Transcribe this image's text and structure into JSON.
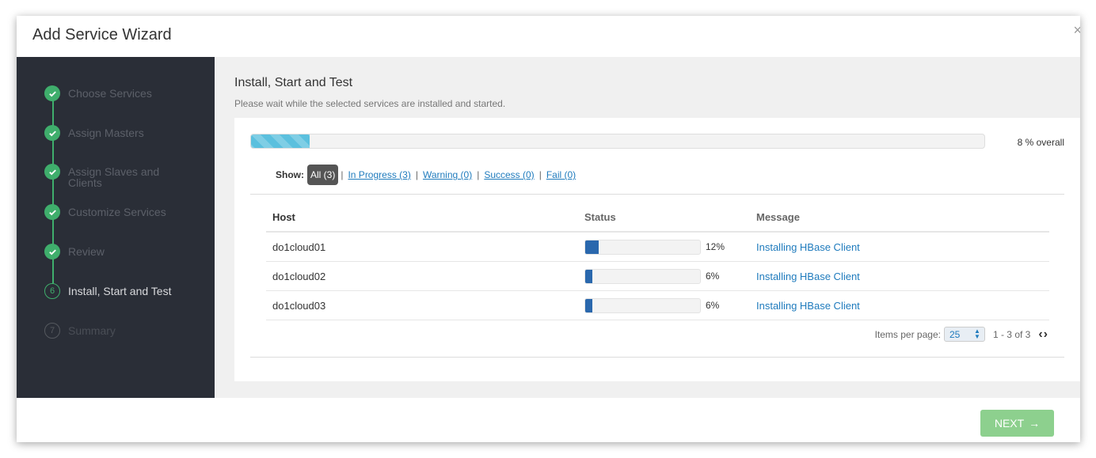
{
  "dialog": {
    "title": "Add Service Wizard",
    "close_glyph": "×"
  },
  "steps": [
    {
      "label": "Choose Services",
      "state": "done",
      "badge": ""
    },
    {
      "label": "Assign Masters",
      "state": "done",
      "badge": ""
    },
    {
      "label": "Assign Slaves and Clients",
      "state": "done",
      "badge": ""
    },
    {
      "label": "Customize Services",
      "state": "done",
      "badge": ""
    },
    {
      "label": "Review",
      "state": "done",
      "badge": ""
    },
    {
      "label": "Install, Start and Test",
      "state": "current",
      "badge": "6"
    },
    {
      "label": "Summary",
      "state": "future",
      "badge": "7"
    }
  ],
  "content": {
    "title": "Install, Start and Test",
    "subtitle": "Please wait while the selected services are installed and started."
  },
  "overall": {
    "percent": 8,
    "text": "8 % overall"
  },
  "filter": {
    "label": "Show:",
    "all": "All (3)",
    "separator": "|",
    "in_progress": "In Progress (3)",
    "warning": "Warning (0)",
    "success": "Success (0)",
    "fail": "Fail (0)"
  },
  "table": {
    "headers": {
      "host": "Host",
      "status": "Status",
      "message": "Message"
    },
    "rows": [
      {
        "host": "do1cloud01",
        "percent": 12,
        "percent_text": "12%",
        "message": "Installing HBase Client"
      },
      {
        "host": "do1cloud02",
        "percent": 6,
        "percent_text": "6%",
        "message": "Installing HBase Client"
      },
      {
        "host": "do1cloud03",
        "percent": 6,
        "percent_text": "6%",
        "message": "Installing HBase Client"
      }
    ]
  },
  "pager": {
    "label": "Items per page:",
    "selected": "25",
    "range": "1 - 3 of 3",
    "prev_glyph": "‹",
    "next_glyph": "›"
  },
  "footer": {
    "next_label": "NEXT",
    "next_arrow": "→"
  },
  "colors": {
    "sidebar_bg": "#2a2e37",
    "step_done": "#3fae6c",
    "progress_overall": "#5bc0de",
    "progress_host": "#2a68ad",
    "link": "#1f7bbd",
    "next_button": "#8dd08e"
  },
  "icons": {
    "done_step": "check-icon",
    "close": "close-icon",
    "prev": "chevron-left-icon",
    "next": "chevron-right-icon",
    "arrow": "arrow-right-icon"
  }
}
